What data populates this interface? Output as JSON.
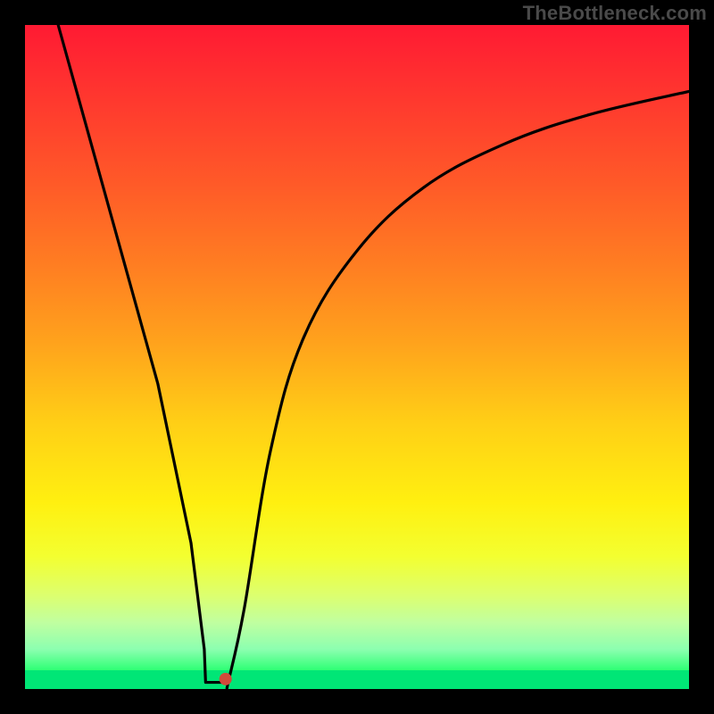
{
  "watermark": "TheBottleneck.com",
  "chart_data": {
    "type": "line",
    "title": "",
    "xlabel": "",
    "ylabel": "",
    "xlim": [
      0,
      100
    ],
    "ylim": [
      0,
      100
    ],
    "background": "rainbow-vertical-red-to-green",
    "series": [
      {
        "name": "bottleneck-curve",
        "x": [
          5,
          10,
          15,
          20,
          25,
          27,
          28.8,
          30.6,
          33,
          37,
          42,
          50,
          60,
          72,
          85,
          100
        ],
        "values": [
          100,
          82,
          64,
          46,
          22,
          6,
          1,
          1,
          12,
          36,
          53,
          66,
          75.5,
          82,
          86.5,
          90
        ]
      }
    ],
    "minimum_point": {
      "x": 30.2,
      "y": 1.5
    },
    "flat_bottom_segment": {
      "x_start": 27.2,
      "x_end": 30.6,
      "y": 1
    }
  },
  "colors": {
    "frame": "#000000",
    "curve": "#000000",
    "min_marker": "#d04a3a"
  }
}
